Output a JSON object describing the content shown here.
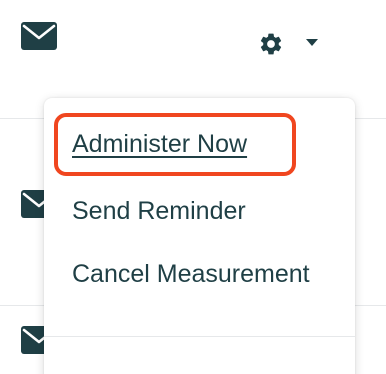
{
  "icons": {
    "mail": "envelope-icon",
    "settings": "gear-icon",
    "menu_toggle": "caret-down-icon"
  },
  "colors": {
    "text": "#1f3f45",
    "icon": "#1f3f45",
    "highlight": "#f0461f",
    "divider": "#e6e8ea"
  },
  "dropdown": {
    "items": [
      {
        "label": "Administer Now",
        "active": true
      },
      {
        "label": "Send Reminder",
        "active": false
      },
      {
        "label": "Cancel Measurement",
        "active": false
      }
    ]
  }
}
